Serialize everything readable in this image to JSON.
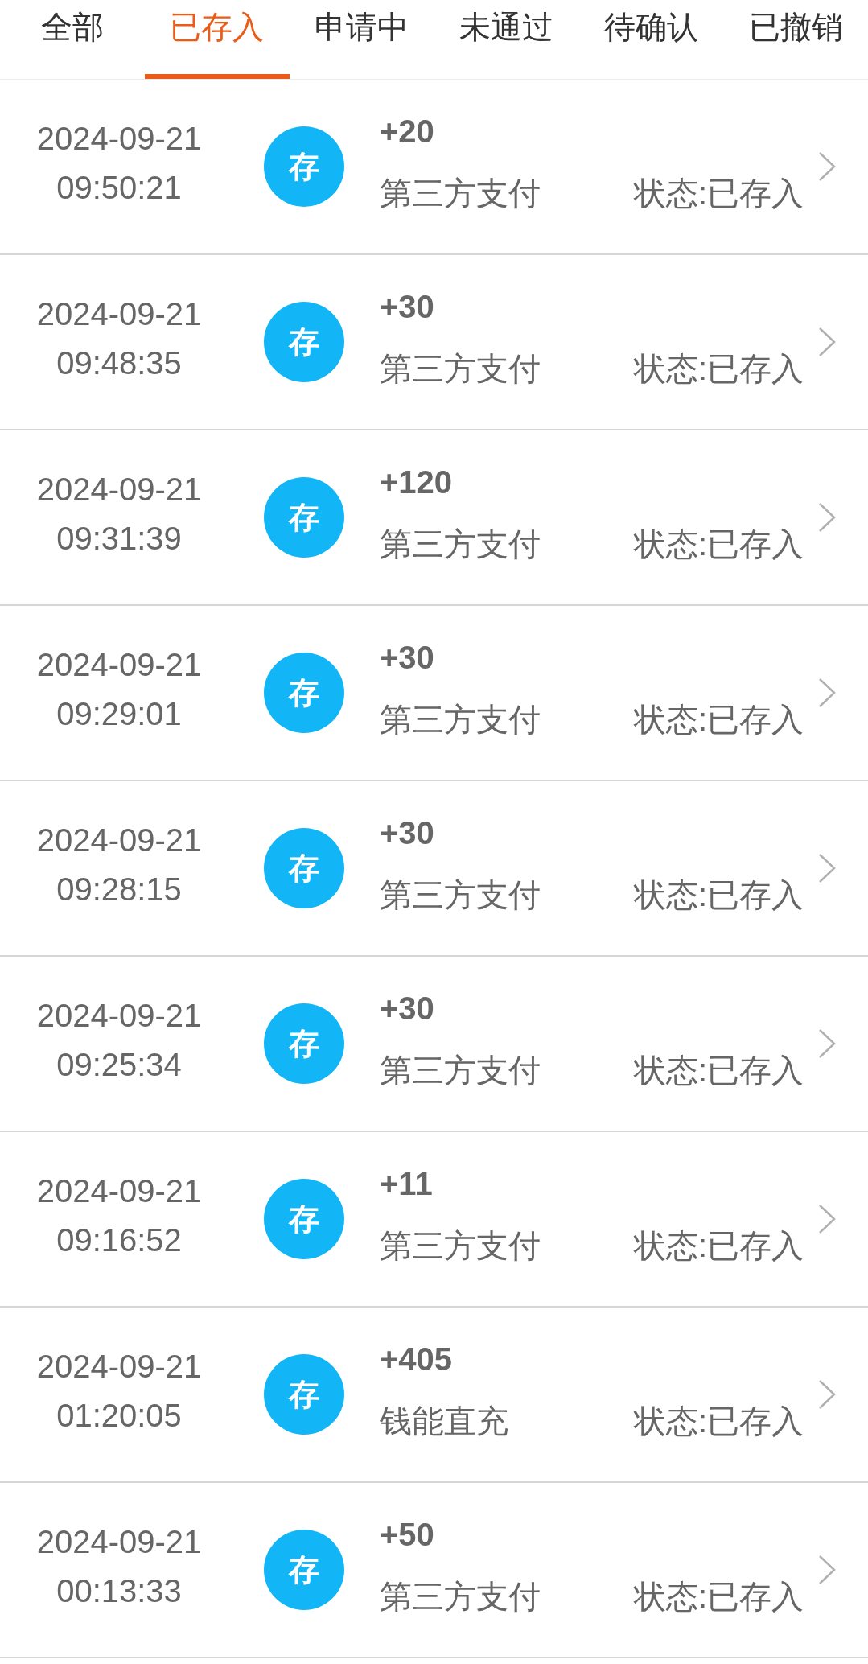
{
  "tabs": [
    {
      "label": "全部",
      "selected": false
    },
    {
      "label": "已存入",
      "selected": true
    },
    {
      "label": "申请中",
      "selected": false
    },
    {
      "label": "未通过",
      "selected": false
    },
    {
      "label": "待确认",
      "selected": false
    },
    {
      "label": "已撤销",
      "selected": false
    }
  ],
  "records": [
    {
      "date": "2024-09-21",
      "time": "09:50:21",
      "badge": "存",
      "amount": "+20",
      "method": "第三方支付",
      "status": "状态:已存入"
    },
    {
      "date": "2024-09-21",
      "time": "09:48:35",
      "badge": "存",
      "amount": "+30",
      "method": "第三方支付",
      "status": "状态:已存入"
    },
    {
      "date": "2024-09-21",
      "time": "09:31:39",
      "badge": "存",
      "amount": "+120",
      "method": "第三方支付",
      "status": "状态:已存入"
    },
    {
      "date": "2024-09-21",
      "time": "09:29:01",
      "badge": "存",
      "amount": "+30",
      "method": "第三方支付",
      "status": "状态:已存入"
    },
    {
      "date": "2024-09-21",
      "time": "09:28:15",
      "badge": "存",
      "amount": "+30",
      "method": "第三方支付",
      "status": "状态:已存入"
    },
    {
      "date": "2024-09-21",
      "time": "09:25:34",
      "badge": "存",
      "amount": "+30",
      "method": "第三方支付",
      "status": "状态:已存入"
    },
    {
      "date": "2024-09-21",
      "time": "09:16:52",
      "badge": "存",
      "amount": "+11",
      "method": "第三方支付",
      "status": "状态:已存入"
    },
    {
      "date": "2024-09-21",
      "time": "01:20:05",
      "badge": "存",
      "amount": "+405",
      "method": "钱能直充",
      "status": "状态:已存入"
    },
    {
      "date": "2024-09-21",
      "time": "00:13:33",
      "badge": "存",
      "amount": "+50",
      "method": "第三方支付",
      "status": "状态:已存入"
    }
  ]
}
